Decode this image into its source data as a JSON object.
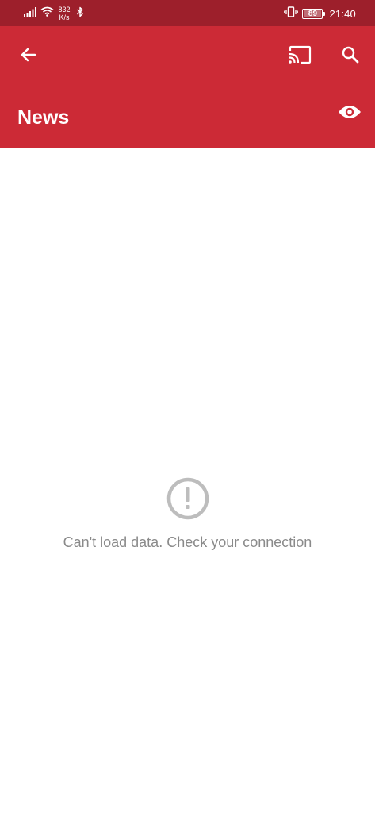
{
  "status_bar": {
    "net_speed_value": "832",
    "net_speed_unit": "K/s",
    "battery_level": "89",
    "time": "21:40",
    "icons": [
      "signal-icon",
      "wifi-icon",
      "bluetooth-icon",
      "vibrate-icon",
      "battery-icon"
    ]
  },
  "app_bar": {
    "title": "News",
    "icons": [
      "back-arrow-icon",
      "cast-icon",
      "search-icon",
      "eye-icon"
    ]
  },
  "empty_state": {
    "icon": "error-circle-icon",
    "message": "Can't load data. Check your connection"
  },
  "colors": {
    "status_bar_bg": "#9d1f2b",
    "app_bar_bg": "#cc2a36",
    "message_text": "#8a8a8a",
    "icon_gray": "#bdbdbd"
  }
}
